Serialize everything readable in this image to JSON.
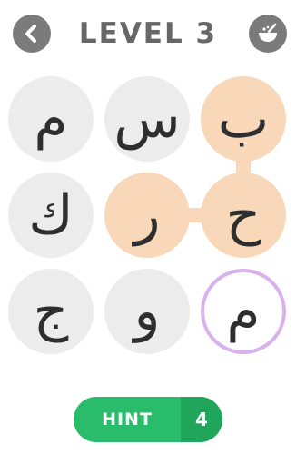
{
  "header": {
    "title": "LEVEL 3",
    "back_icon": "back-arrow-icon",
    "shop_icon": "bowl-icon"
  },
  "board": {
    "tiles": [
      {
        "letter": "م",
        "state": "idle"
      },
      {
        "letter": "س",
        "state": "idle"
      },
      {
        "letter": "ب",
        "state": "selected"
      },
      {
        "letter": "ك",
        "state": "idle"
      },
      {
        "letter": "ر",
        "state": "selected"
      },
      {
        "letter": "ح",
        "state": "selected"
      },
      {
        "letter": "ج",
        "state": "idle"
      },
      {
        "letter": "و",
        "state": "idle"
      },
      {
        "letter": "م",
        "state": "hinted"
      }
    ]
  },
  "hint": {
    "label": "HINT",
    "count": "4"
  },
  "colors": {
    "tile": "#ececec",
    "selected": "#f8d8b8",
    "hint_ring": "#d7b2ec",
    "hint_button": "#29bd6b",
    "hint_count_bg": "#1fa65b",
    "header_icon_bg": "#7b7b7b"
  }
}
